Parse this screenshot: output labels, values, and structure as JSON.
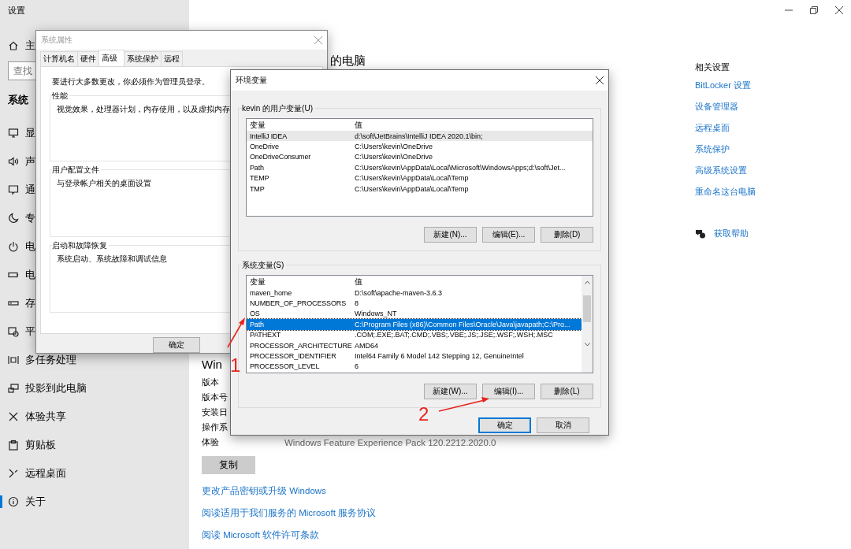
{
  "settings": {
    "title": "设置",
    "sidebar": {
      "home": "主",
      "search": {
        "placeholder": "查找"
      },
      "section": "系统",
      "items": [
        {
          "label": "显",
          "kind": "display",
          "selected": false
        },
        {
          "label": "声",
          "kind": "sound",
          "selected": false
        },
        {
          "label": "通",
          "kind": "notify",
          "selected": false
        },
        {
          "label": "专",
          "kind": "moon",
          "selected": false
        },
        {
          "label": "电",
          "kind": "power",
          "selected": false
        },
        {
          "label": "电",
          "kind": "battery",
          "selected": false
        },
        {
          "label": "存",
          "kind": "storage",
          "selected": false
        },
        {
          "label": "平",
          "kind": "tablet",
          "selected": false
        },
        {
          "label": "多任务处理",
          "kind": "multitask",
          "selected": false
        },
        {
          "label": "投影到此电脑",
          "kind": "project",
          "selected": false
        },
        {
          "label": "体验共享",
          "kind": "share",
          "selected": false
        },
        {
          "label": "剪贴板",
          "kind": "clipboard",
          "selected": false
        },
        {
          "label": "远程桌面",
          "kind": "remote",
          "selected": false
        },
        {
          "label": "关于",
          "kind": "info",
          "selected": true
        }
      ]
    },
    "main": {
      "heading": "的电脑",
      "spec_heading": "Win",
      "specs": [
        {
          "label": "版本"
        },
        {
          "label": "版本号"
        },
        {
          "label": "安装日"
        },
        {
          "label": "操作系"
        },
        {
          "label": "体验",
          "value": "Windows Feature Experience Pack 120.2212.2020.0"
        }
      ],
      "copy_button": "复制",
      "links": [
        "更改产品密钥或升级 Windows",
        "阅读适用于我们服务的 Microsoft 服务协议",
        "阅读 Microsoft 软件许可条款"
      ]
    },
    "related": {
      "title": "相关设置",
      "links": [
        "BitLocker 设置",
        "设备管理器",
        "远程桌面",
        "系统保护",
        "高级系统设置",
        "重命名这台电脑"
      ],
      "help": "获取帮助"
    }
  },
  "system_properties": {
    "title": "系统属性",
    "tabs": [
      {
        "label": "计算机名",
        "selected": false
      },
      {
        "label": "硬件",
        "selected": false
      },
      {
        "label": "高级",
        "selected": true
      },
      {
        "label": "系统保护",
        "selected": false
      },
      {
        "label": "远程",
        "selected": false
      }
    ],
    "notice": "要进行大多数更改，你必须作为管理员登录。",
    "groups": [
      {
        "title": "性能",
        "text": "视觉效果，处理器计划，内存使用，以及虚拟内存"
      },
      {
        "title": "用户配置文件",
        "text": "与登录帐户相关的桌面设置"
      },
      {
        "title": "启动和故障恢复",
        "text": "系统启动、系统故障和调试信息"
      }
    ],
    "buttons": [
      "确定"
    ]
  },
  "environment_variables": {
    "title": "环境变量",
    "user_vars": {
      "title": "kevin 的用户变量(U)",
      "columns": [
        "变量",
        "值"
      ],
      "rows": [
        {
          "name": "IntelliJ IDEA",
          "value": "d:\\soft\\JetBrains\\IntelliJ IDEA 2020.1\\bin;",
          "selected": true
        },
        {
          "name": "OneDrive",
          "value": "C:\\Users\\kevin\\OneDrive",
          "selected": false
        },
        {
          "name": "OneDriveConsumer",
          "value": "C:\\Users\\kevin\\OneDrive",
          "selected": false
        },
        {
          "name": "Path",
          "value": "C:\\Users\\kevin\\AppData\\Local\\Microsoft\\WindowsApps;d:\\soft\\Jet...",
          "selected": false
        },
        {
          "name": "TEMP",
          "value": "C:\\Users\\kevin\\AppData\\Local\\Temp",
          "selected": false
        },
        {
          "name": "TMP",
          "value": "C:\\Users\\kevin\\AppData\\Local\\Temp",
          "selected": false
        }
      ],
      "buttons": [
        "新建(N)...",
        "编辑(E)...",
        "删除(D)"
      ]
    },
    "system_vars": {
      "title": "系统变量(S)",
      "columns": [
        "变量",
        "值"
      ],
      "rows": [
        {
          "name": "maven_home",
          "value": "D:\\soft\\apache-maven-3.6.3",
          "selected": false
        },
        {
          "name": "NUMBER_OF_PROCESSORS",
          "value": "8",
          "selected": false
        },
        {
          "name": "OS",
          "value": "Windows_NT",
          "selected": false
        },
        {
          "name": "Path",
          "value": "C:\\Program Files (x86)\\Common Files\\Oracle\\Java\\javapath;C:\\Pro...",
          "selected": true
        },
        {
          "name": "PATHEXT",
          "value": ".COM;.EXE;.BAT;.CMD;.VBS;.VBE;.JS;.JSE;.WSF;.WSH;.MSC",
          "selected": false
        },
        {
          "name": "PROCESSOR_ARCHITECTURE",
          "value": "AMD64",
          "selected": false
        },
        {
          "name": "PROCESSOR_IDENTIFIER",
          "value": "Intel64 Family 6 Model 142 Stepping 12, GenuineIntel",
          "selected": false
        },
        {
          "name": "PROCESSOR_LEVEL",
          "value": "6",
          "selected": false
        }
      ],
      "buttons": [
        "新建(W)...",
        "编辑(I)...",
        "删除(L)"
      ]
    },
    "buttons": [
      "确定",
      "取消"
    ]
  },
  "annotations": [
    {
      "label": "1"
    },
    {
      "label": "2"
    }
  ]
}
